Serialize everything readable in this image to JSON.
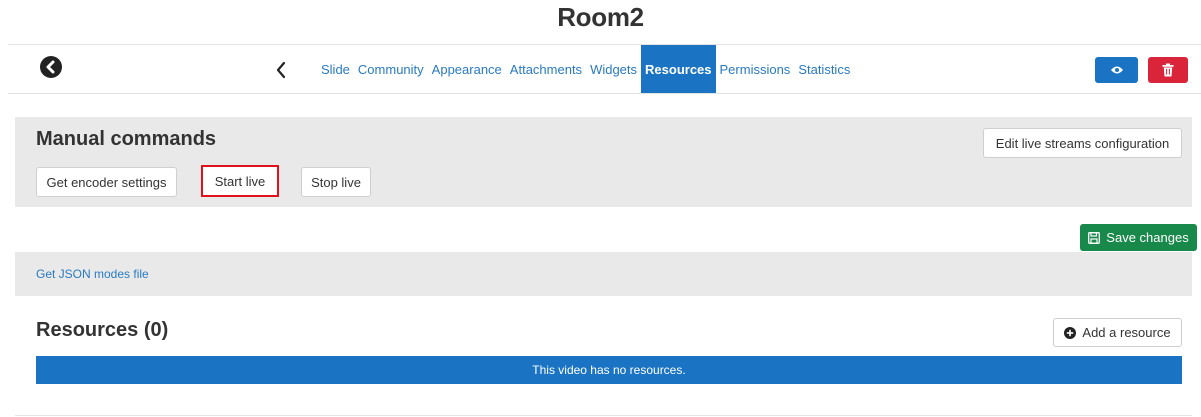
{
  "page": {
    "title": "Room2"
  },
  "nav": {
    "back_icon": "circle-chevron-left-icon",
    "prev_icon": "chevron-left-icon",
    "tabs": [
      {
        "label": "Slide",
        "active": false
      },
      {
        "label": "Community",
        "active": false
      },
      {
        "label": "Appearance",
        "active": false
      },
      {
        "label": "Attachments",
        "active": false
      },
      {
        "label": "Widgets",
        "active": false
      },
      {
        "label": "Resources",
        "active": true
      },
      {
        "label": "Permissions",
        "active": false
      },
      {
        "label": "Statistics",
        "active": false
      }
    ],
    "view_icon": "eye-icon",
    "delete_icon": "trash-icon"
  },
  "manual": {
    "title": "Manual commands",
    "get_encoder_label": "Get encoder settings",
    "start_live_label": "Start live",
    "stop_live_label": "Stop live",
    "edit_streams_label": "Edit live streams configuration"
  },
  "save": {
    "label": "Save changes",
    "icon": "save-icon"
  },
  "json": {
    "link_label": "Get JSON modes file"
  },
  "resources": {
    "title": "Resources (0)",
    "add_label": "Add a resource",
    "add_icon": "plus-circle-icon",
    "empty_message": "This video has no resources."
  },
  "colors": {
    "primary": "#1b74c3",
    "danger": "#d9243a",
    "success": "#18894a",
    "link": "#2a7ac0",
    "highlight": "#e0121a",
    "panel": "#e9e9e9"
  }
}
